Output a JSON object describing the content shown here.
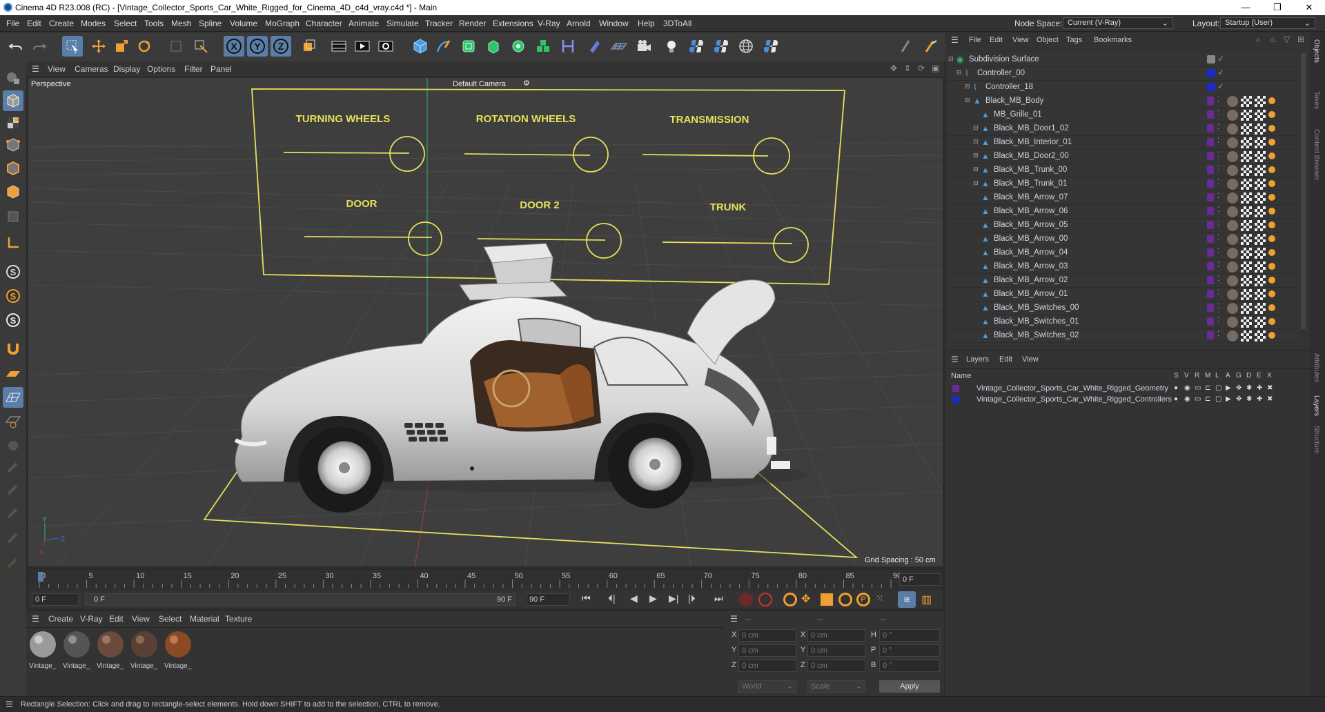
{
  "title": "Cinema 4D R23.008 (RC) - [Vintage_Collector_Sports_Car_White_Rigged_for_Cinema_4D_c4d_vray.c4d *] - Main",
  "menu": [
    "File",
    "Edit",
    "Create",
    "Modes",
    "Select",
    "Tools",
    "Mesh",
    "Spline",
    "Volume",
    "MoGraph",
    "Character",
    "Animate",
    "Simulate",
    "Tracker",
    "Render",
    "Extensions",
    "V-Ray",
    "Arnold",
    "Window",
    "Help",
    "3DToAll"
  ],
  "node_space_label": "Node Space:",
  "node_space_value": "Current (V-Ray)",
  "layout_label": "Layout:",
  "layout_value": "Startup (User)",
  "viewport_menu": [
    "View",
    "Cameras",
    "Display",
    "Options",
    "Filter",
    "Panel"
  ],
  "viewport_name": "Perspective",
  "camera_name": "Default Camera",
  "grid_spacing": "Grid Spacing : 50 cm",
  "controller_labels": [
    "TURNING WHEELS",
    "ROTATION WHEELS",
    "TRANSMISSION",
    "DOOR",
    "DOOR 2",
    "TRUNK"
  ],
  "axis_y": "Y",
  "axis_z": "Z",
  "axis_x": "X",
  "timeline_ticks": [
    "0",
    "5",
    "10",
    "15",
    "20",
    "25",
    "30",
    "35",
    "40",
    "45",
    "50",
    "55",
    "60",
    "65",
    "70",
    "75",
    "80",
    "85",
    "90"
  ],
  "current_frame": "0 F",
  "transport": {
    "start": "0 F",
    "range_start": "0 F",
    "range_end": "90 F",
    "end": "90 F"
  },
  "material_menu": [
    "Create",
    "V-Ray",
    "Edit",
    "View",
    "Select",
    "Material",
    "Texture"
  ],
  "materials": [
    "Vintage_",
    "Vintage_",
    "Vintage_",
    "Vintage_",
    "Vintage_"
  ],
  "coords": {
    "header": [
      "--",
      "--",
      "--"
    ],
    "rows": [
      {
        "axis": "X",
        "pos": "0 cm",
        "axis2": "X",
        "size": "0 cm",
        "axis3": "H",
        "rot": "0 °"
      },
      {
        "axis": "Y",
        "pos": "0 cm",
        "axis2": "Y",
        "size": "0 cm",
        "axis3": "P",
        "rot": "0 °"
      },
      {
        "axis": "Z",
        "pos": "0 cm",
        "axis2": "Z",
        "size": "0 cm",
        "axis3": "B",
        "rot": "0 °"
      }
    ],
    "world": "World",
    "scale": "Scale",
    "apply": "Apply"
  },
  "object_menu": [
    "File",
    "Edit",
    "View",
    "Object",
    "Tags",
    "Bookmarks"
  ],
  "objects": [
    {
      "name": "Subdivision Surface",
      "indent": 0
    },
    {
      "name": "Controller_00",
      "indent": 1
    },
    {
      "name": "Controller_18",
      "indent": 2
    },
    {
      "name": "Black_MB_Body",
      "indent": 2
    },
    {
      "name": "MB_Grille_01",
      "indent": 3
    },
    {
      "name": "Black_MB_Door1_02",
      "indent": 3
    },
    {
      "name": "Black_MB_Interior_01",
      "indent": 3
    },
    {
      "name": "Black_MB_Door2_00",
      "indent": 3
    },
    {
      "name": "Black_MB_Trunk_00",
      "indent": 3
    },
    {
      "name": "Black_MB_Trunk_01",
      "indent": 3
    },
    {
      "name": "Black_MB_Arrow_07",
      "indent": 3
    },
    {
      "name": "Black_MB_Arrow_06",
      "indent": 3
    },
    {
      "name": "Black_MB_Arrow_05",
      "indent": 3
    },
    {
      "name": "Black_MB_Arrow_00",
      "indent": 3
    },
    {
      "name": "Black_MB_Arrow_04",
      "indent": 3
    },
    {
      "name": "Black_MB_Arrow_03",
      "indent": 3
    },
    {
      "name": "Black_MB_Arrow_02",
      "indent": 3
    },
    {
      "name": "Black_MB_Arrow_01",
      "indent": 3
    },
    {
      "name": "Black_MB_Switches_00",
      "indent": 3
    },
    {
      "name": "Black_MB_Switches_01",
      "indent": 3
    },
    {
      "name": "Black_MB_Switches_02",
      "indent": 3
    }
  ],
  "layers_menu": [
    "Layers",
    "Edit",
    "View"
  ],
  "layers_header": {
    "name": "Name",
    "cols": [
      "S",
      "V",
      "R",
      "M",
      "L",
      "A",
      "G",
      "D",
      "E",
      "X"
    ]
  },
  "layers": [
    {
      "name": "Vintage_Collector_Sports_Car_White_Rigged_Geometry",
      "color": "#6a2a9a"
    },
    {
      "name": "Vintage_Collector_Sports_Car_White_Rigged_Controllers",
      "color": "#1a2acc"
    }
  ],
  "right_tabs": [
    "Objects",
    "Takes",
    "Content Browser",
    "Attributes",
    "Layers",
    "Structure"
  ],
  "status": "Rectangle Selection: Click and drag to rectangle-select elements. Hold down SHIFT to add to the selection, CTRL to remove.",
  "colors": {
    "accent": "#5a7ea8",
    "controller_yellow": "#e6e05a",
    "leather": "#a0612e"
  }
}
